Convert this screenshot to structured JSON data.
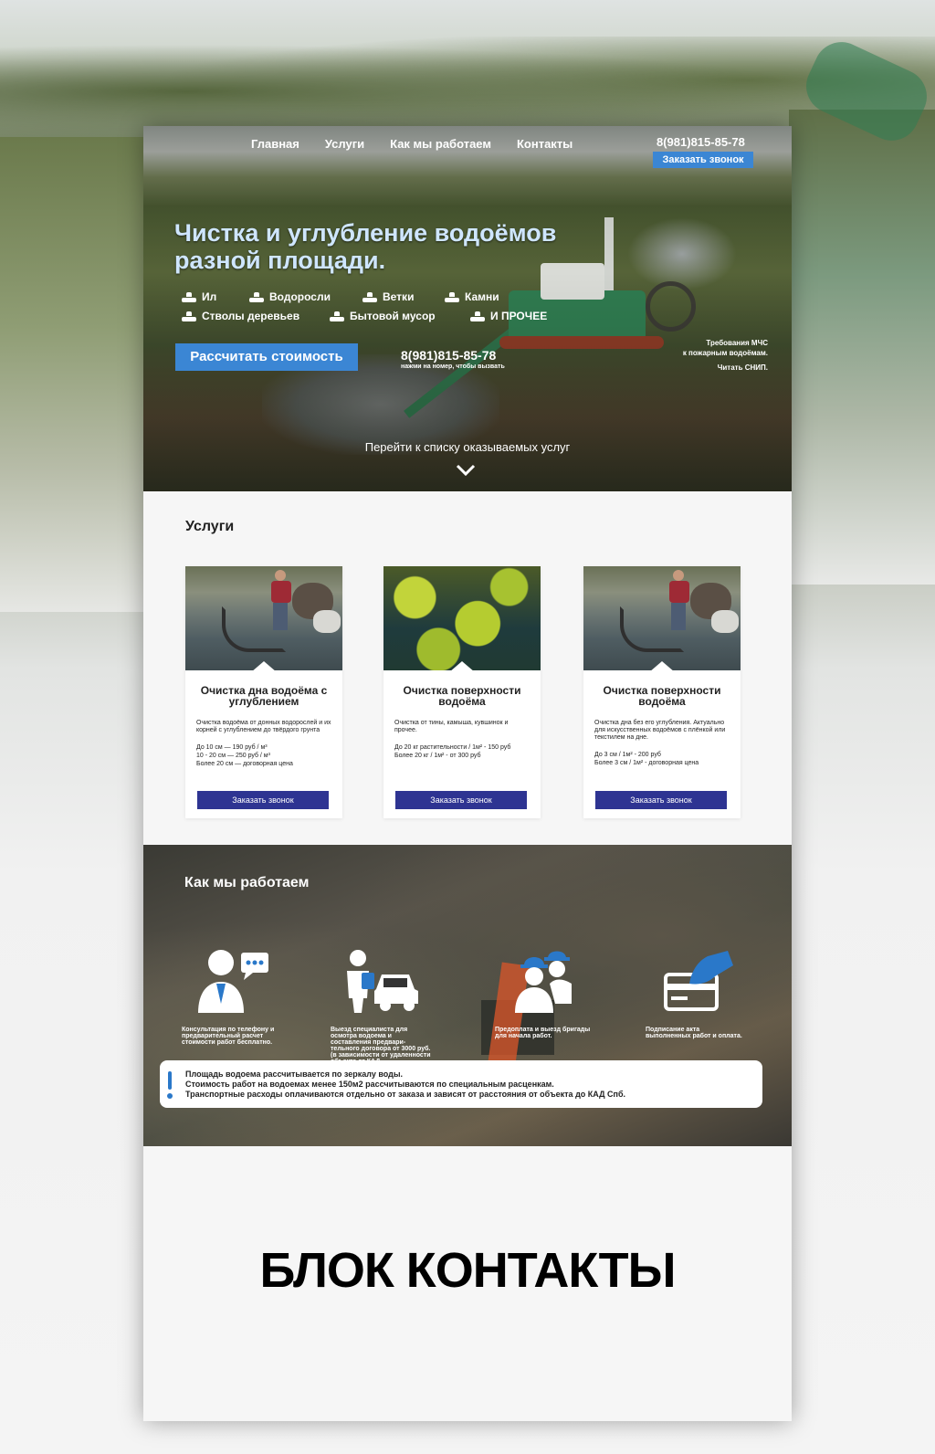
{
  "colors": {
    "accent": "#3b86d4",
    "card_button": "#2e3492",
    "hero_title": "#cfe6ff"
  },
  "nav": {
    "items": [
      "Главная",
      "Услуги",
      "Как мы работаем",
      "Контакты"
    ]
  },
  "header": {
    "phone": "8(981)815-85-78",
    "call_button": "Заказать звонок"
  },
  "hero": {
    "title": "Чистка и углубление водоёмов разной площади.",
    "features": [
      "Ил",
      "Водоросли",
      "Ветки",
      "Камни",
      "Стволы деревьев",
      "Бытовой мусор",
      "И ПРОЧЕЕ"
    ],
    "calc_button": "Рассчитать стоимость",
    "phone": "8(981)815-85-78",
    "phone_note": "нажми на номер, чтобы вызвать",
    "mchs_line1": "Требования МЧС",
    "mchs_line2": "к пожарным водоёмам.",
    "mchs_link": "Читать СНИП.",
    "goto_services": "Перейти к списку оказываемых услуг"
  },
  "services": {
    "title": "Услуги",
    "cards": [
      {
        "title": "Очистка дна водоёма с углублением",
        "desc": "Очистка водоёма от донных водорослей и их корней с углублением до твёрдого грунта",
        "prices": [
          "До 10 см — 190 руб / м³",
          "10 - 20 см — 250 руб / м³",
          "Более 20 см — договорная цена"
        ],
        "button": "Заказать звонок"
      },
      {
        "title": "Очистка поверхности водоёма",
        "desc": "Очистка от тины, камыша, кувшинок и прочее.",
        "prices": [
          "До 20 кг растительности / 1м² - 150 руб",
          "Более 20 кг / 1м² - от 300 руб"
        ],
        "button": "Заказать звонок"
      },
      {
        "title": "Очистка поверхности водоёма",
        "desc": "Очистка дна без его углубления. Актуально для искусственных водоёмов с плёнкой или текстилем на дне.",
        "prices": [
          "До 3 см / 1м² - 200 руб",
          "Более 3 см / 1м² - договорная цена"
        ],
        "button": "Заказать звонок"
      }
    ]
  },
  "how": {
    "title": "Как мы работаем",
    "steps": [
      {
        "icon": "consultant-icon",
        "caption": "Консультация по телефону и предварительный расчет стоимости работ бесплатно."
      },
      {
        "icon": "specialist-car-icon",
        "caption": "Выезд специалиста для осмотра водоема и составления предвари- тельного договора от 3000 руб. (в зависимости от удаленности объекта от КАД."
      },
      {
        "icon": "workers-icon",
        "caption": "Предоплата и выезд бригады для начала работ."
      },
      {
        "icon": "card-payment-icon",
        "caption": "Подписание акта выполненных работ и оплата."
      }
    ],
    "note_lines": [
      "Площадь водоема рассчитывается по зеркалу воды.",
      "Стоимость работ на водоемах менее 150м2 рассчитываются по специальным расценкам.",
      "Транспортные расходы оплачиваются отдельно от заказа и зависят от расстояния от объекта до КАД Спб."
    ]
  },
  "contacts": {
    "label": "БЛОК КОНТАКТЫ"
  }
}
